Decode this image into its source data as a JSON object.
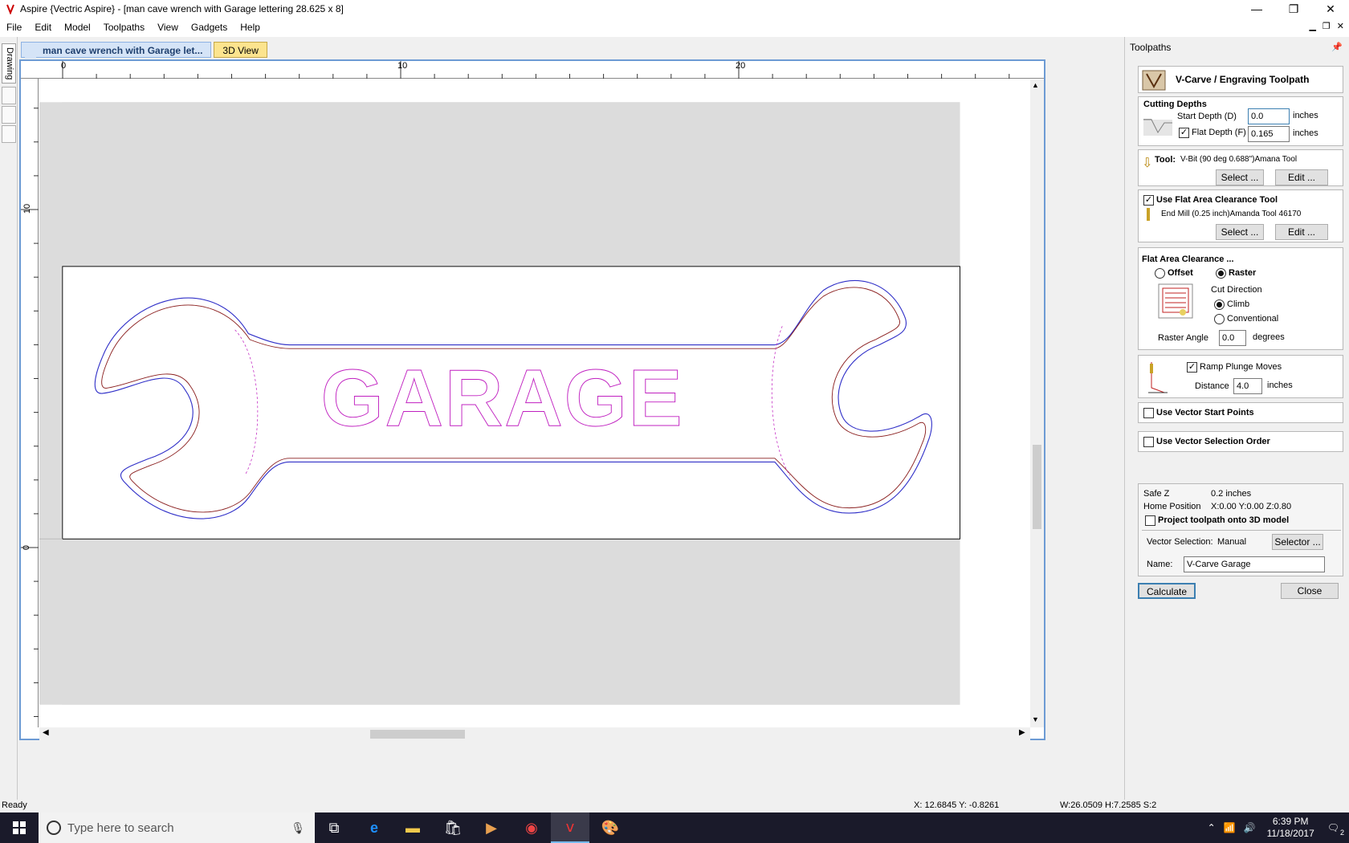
{
  "window": {
    "title": "Aspire {Vectric Aspire} - [man cave wrench with Garage lettering 28.625 x 8]",
    "minimize": "—",
    "restore": "❐",
    "close": "✕"
  },
  "menu": [
    "File",
    "Edit",
    "Model",
    "Toolpaths",
    "View",
    "Gadgets",
    "Help"
  ],
  "side_tab": "Drawing",
  "doc_tabs": {
    "active": "man cave wrench with Garage let...",
    "second": "3D View"
  },
  "ruler": {
    "top_labels": [
      "0",
      "10",
      "20"
    ],
    "left_labels": [
      "10",
      "0"
    ]
  },
  "artwork": {
    "text": "GARAGE",
    "outline_color": "#3030c8",
    "inner_color": "#8b2020",
    "text_color": "#c020c0"
  },
  "panel": {
    "header": "Toolpaths",
    "title": "V-Carve / Engraving Toolpath",
    "cutting_depths": {
      "heading": "Cutting Depths",
      "start_label": "Start Depth (D)",
      "start_value": "0.0",
      "flat_label": "Flat Depth (F)",
      "flat_value": "0.165",
      "flat_checked": true,
      "unit": "inches"
    },
    "tool": {
      "label": "Tool:",
      "name": "V-Bit (90 deg 0.688\")Amana Tool",
      "select": "Select ...",
      "edit": "Edit ..."
    },
    "flat_area_tool": {
      "label": "Use Flat Area Clearance Tool",
      "checked": true,
      "name": "End Mill (0.25 inch)Amanda Tool 46170",
      "select": "Select ...",
      "edit": "Edit ..."
    },
    "flat_area_clearance": {
      "heading": "Flat Area Clearance ...",
      "offset": "Offset",
      "raster": "Raster",
      "cut_direction": "Cut Direction",
      "climb": "Climb",
      "conventional": "Conventional",
      "raster_angle_label": "Raster Angle",
      "raster_angle_value": "0.0",
      "raster_angle_unit": "degrees"
    },
    "ramp": {
      "label": "Ramp Plunge Moves",
      "checked": true,
      "distance_label": "Distance",
      "distance_value": "4.0",
      "unit": "inches"
    },
    "vector_start_points": "Use Vector Start Points",
    "vector_selection_order": "Use Vector Selection Order",
    "safe_z_label": "Safe Z",
    "safe_z_value": "0.2 inches",
    "home_label": "Home Position",
    "home_value": "X:0.00 Y:0.00 Z:0.80",
    "project_label": "Project toolpath onto 3D model",
    "vector_selection_label": "Vector Selection:",
    "vector_selection_value": "Manual",
    "selector_button": "Selector ...",
    "name_label": "Name:",
    "name_value": "V-Carve Garage",
    "calculate": "Calculate",
    "close": "Close"
  },
  "status": {
    "ready": "Ready",
    "coords": "X: 12.6845 Y: -0.8261",
    "size": "W:26.0509  H:7.2585  S:2"
  },
  "taskbar": {
    "search_placeholder": "Type here to search",
    "time": "6:39 PM",
    "date": "11/18/2017",
    "notification_count": "2"
  }
}
